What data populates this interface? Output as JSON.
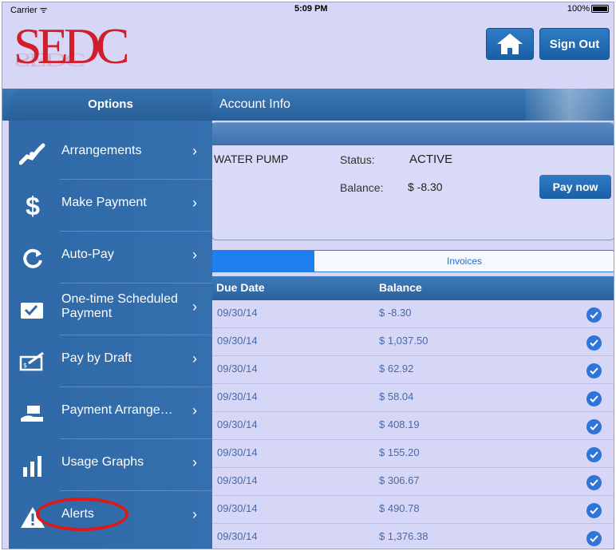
{
  "status_bar": {
    "carrier": "Carrier ᯤ",
    "time": "5:09 PM",
    "battery": "100%"
  },
  "header": {
    "logo": "SEDC",
    "sign_out": "Sign Out"
  },
  "sidebar": {
    "title": "Options",
    "items": [
      {
        "label": "Arrangements",
        "icon": "handshake-icon"
      },
      {
        "label": "Make Payment",
        "icon": "dollar-icon"
      },
      {
        "label": "Auto-Pay",
        "icon": "refresh-icon"
      },
      {
        "label": "One-time Scheduled Payment",
        "icon": "wallet-check-icon"
      },
      {
        "label": "Pay by Draft",
        "icon": "check-sign-icon"
      },
      {
        "label": "Payment Arrange…",
        "icon": "hand-money-icon"
      },
      {
        "label": "Usage Graphs",
        "icon": "bar-chart-icon"
      },
      {
        "label": "Alerts",
        "icon": "warning-icon"
      }
    ]
  },
  "account": {
    "title": "Account Info",
    "name": "WATER PUMP",
    "status_label": "Status:",
    "status_value": "ACTIVE",
    "balance_label": "Balance:",
    "balance_value": "$ -8.30",
    "pay_now": "Pay now"
  },
  "tabs": [
    {
      "label": "",
      "active": true
    },
    {
      "label": "Invoices",
      "active": false
    }
  ],
  "table": {
    "columns": [
      "Due Date",
      "Balance"
    ],
    "rows": [
      {
        "date": "09/30/14",
        "balance": "$ -8.30"
      },
      {
        "date": "09/30/14",
        "balance": "$ 1,037.50"
      },
      {
        "date": "09/30/14",
        "balance": "$ 62.92"
      },
      {
        "date": "09/30/14",
        "balance": "$ 58.04"
      },
      {
        "date": "09/30/14",
        "balance": "$ 408.19"
      },
      {
        "date": "09/30/14",
        "balance": "$ 155.20"
      },
      {
        "date": "09/30/14",
        "balance": "$ 306.67"
      },
      {
        "date": "09/30/14",
        "balance": "$ 490.78"
      },
      {
        "date": "09/30/14",
        "balance": "$ 1,376.38"
      }
    ]
  },
  "colors": {
    "accent": "#1d7ff0",
    "nav": "#2f69a7",
    "logo": "#d01f2a",
    "highlight": "#e01818"
  }
}
